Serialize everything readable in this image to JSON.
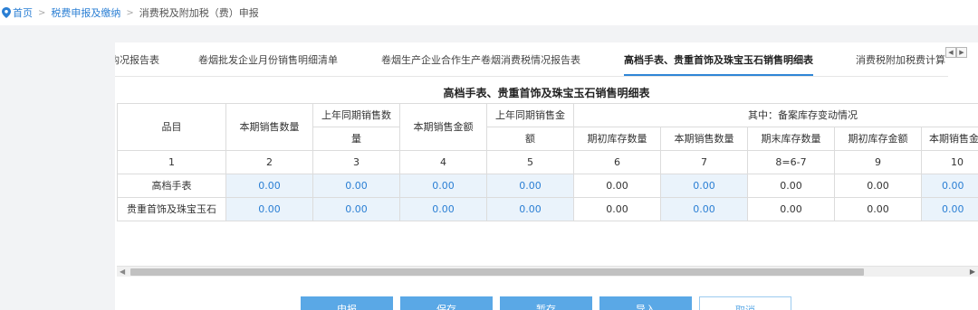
{
  "breadcrumb": {
    "home": "首页",
    "section": "税费申报及缴纳",
    "current": "消费税及附加税（费）申报",
    "separator": ">"
  },
  "tabs": [
    {
      "label": "构况报告表",
      "active": false
    },
    {
      "label": "卷烟批发企业月份销售明细清单",
      "active": false
    },
    {
      "label": "卷烟生产企业合作生产卷烟消费税情况报告表",
      "active": false
    },
    {
      "label": "高档手表、贵重首饰及珠宝玉石销售明细表",
      "active": true
    },
    {
      "label": "消费税附加税费计算",
      "active": false
    }
  ],
  "tab_scroll": {
    "left": "◀",
    "right": "▶"
  },
  "table": {
    "title": "高档手表、贵重首饰及珠宝玉石销售明细表",
    "headers": {
      "category": "品目",
      "current_qty": "本期销售数量",
      "prev_qty_line1": "上年同期销售数",
      "prev_qty_line2": "量",
      "current_amount": "本期销售金额",
      "prev_amount_line1": "上年同期销售金",
      "prev_amount_line2": "额",
      "group": "其中：备案库存变动情况",
      "sub": [
        "期初库存数量",
        "本期销售数量",
        "期末库存数量",
        "期初库存金额",
        "本期销售金"
      ]
    },
    "numbers": [
      "1",
      "2",
      "3",
      "4",
      "5",
      "6",
      "7",
      "8=6-7",
      "9",
      "10"
    ],
    "rows": [
      {
        "label": "高档手表",
        "values": [
          "0.00",
          "0.00",
          "0.00",
          "0.00",
          "0.00",
          "0.00",
          "0.00",
          "0.00",
          "0.00"
        ]
      },
      {
        "label": "贵重首饰及珠宝玉石",
        "values": [
          "0.00",
          "0.00",
          "0.00",
          "0.00",
          "0.00",
          "0.00",
          "0.00",
          "0.00",
          "0.00"
        ]
      }
    ]
  },
  "scrollbar": {
    "left": "◀",
    "right": "▶"
  },
  "buttons": {
    "declare": "申报",
    "save": "保存",
    "temp_save": "暂存",
    "import": "导入",
    "cancel": "取消"
  },
  "colors": {
    "accent": "#2f86d6",
    "button": "#5aa8e6",
    "editable_cell": "#eaf3fb"
  }
}
